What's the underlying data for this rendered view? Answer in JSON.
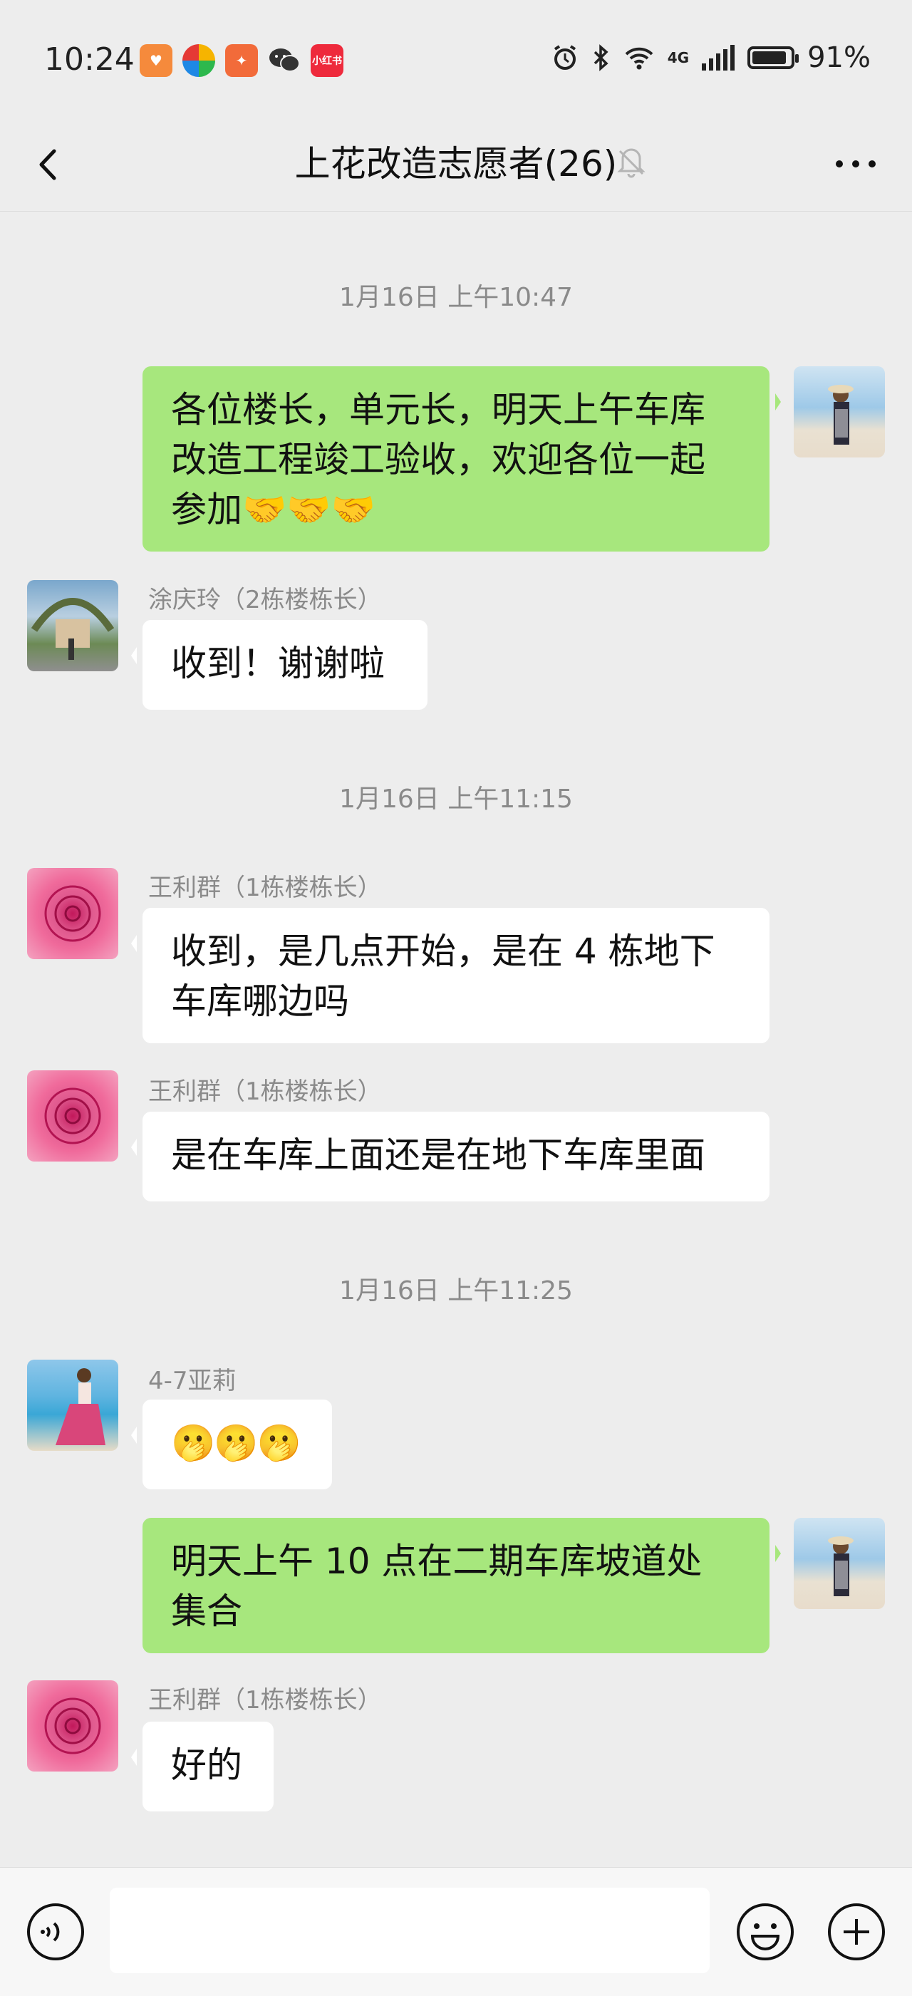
{
  "status_bar": {
    "time": "10:24",
    "app_icons": [
      {
        "name": "heart-app-icon",
        "color": "#f58a3c",
        "glyph": "♥"
      },
      {
        "name": "pinwheel-app-icon",
        "color": "#ffffff",
        "glyph": "✿"
      },
      {
        "name": "runner-app-icon",
        "color": "#f26b3a",
        "glyph": "✦"
      },
      {
        "name": "wechat-app-icon",
        "color": "#3a3a3a",
        "glyph": "💬"
      },
      {
        "name": "xiaohongshu-app-icon",
        "color": "#ee2a3c",
        "glyph": "小红书"
      }
    ],
    "network": "4G",
    "battery": "91%",
    "battery_level": 0.91
  },
  "header": {
    "title": "上花改造志愿者(26)",
    "muted": true
  },
  "chat": {
    "messages": [
      {
        "type": "timestamp",
        "text": "1月16日 上午10:47"
      },
      {
        "type": "out",
        "lines": [
          "各位楼长，单元长，明天上午车库",
          "改造工程竣工验收，欢迎各位一起",
          "参加🤝🤝🤝"
        ]
      },
      {
        "type": "in",
        "sender": "涂庆玲（2栋楼栋长）",
        "text": "收到！谢谢啦"
      },
      {
        "type": "timestamp",
        "text": "1月16日 上午11:15"
      },
      {
        "type": "in",
        "sender": "王利群（1栋楼栋长）",
        "lines": [
          "收到，是几点开始，是在 4 栋地下",
          "车库哪边吗"
        ]
      },
      {
        "type": "in",
        "sender": "王利群（1栋楼栋长）",
        "text": "是在车库上面还是在地下车库里面"
      },
      {
        "type": "timestamp",
        "text": "1月16日 上午11:25"
      },
      {
        "type": "in",
        "sender": "4-7亚莉",
        "text": "🫢🫢🫢"
      },
      {
        "type": "out",
        "lines": [
          "明天上午 10 点在二期车库坡道处",
          "集合"
        ]
      },
      {
        "type": "in",
        "sender": "王利群（1栋楼栋长）",
        "text": "好的"
      }
    ]
  },
  "input_bar": {
    "value": "",
    "placeholder": ""
  },
  "colors": {
    "background": "#ededed",
    "outgoing_bubble": "#a7e77d",
    "incoming_bubble": "#ffffff",
    "meta_text": "#8a8a8a"
  }
}
